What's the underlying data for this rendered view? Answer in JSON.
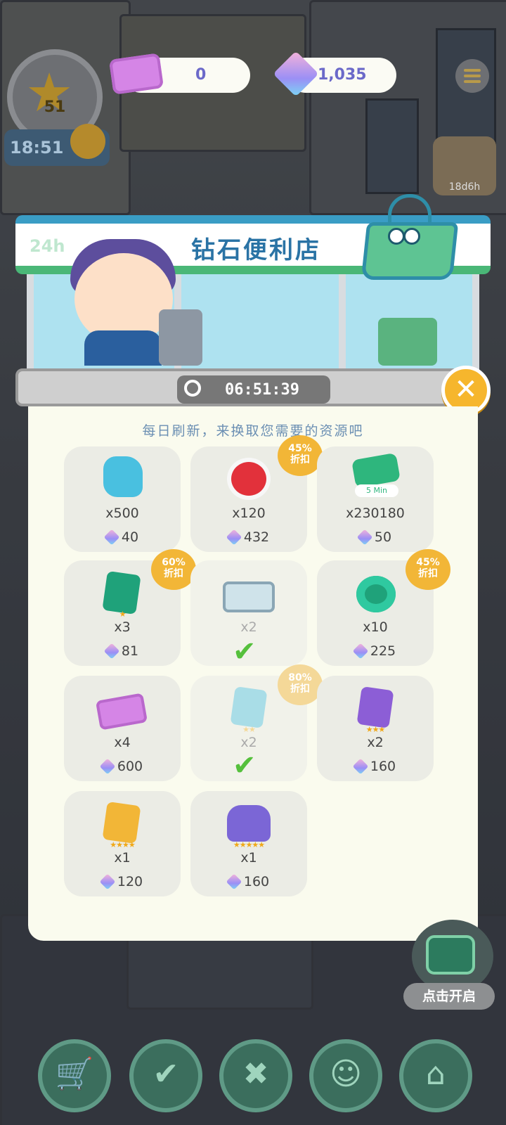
{
  "hud": {
    "level": "51",
    "time": "18:51",
    "tickets": "0",
    "diamonds": "1,035",
    "side_timer": "18d6h"
  },
  "shop": {
    "tag_24h": "24h",
    "title": "钻石便利店",
    "countdown": "06:51:39",
    "subtitle": "每日刷新，来换取您需要的资源吧",
    "items": [
      {
        "icon": "blue-puzzle-icon",
        "qty": "x500",
        "price": "40",
        "badge": "",
        "purchased": false
      },
      {
        "icon": "red-flower-icon",
        "qty": "x120",
        "price": "432",
        "badge": "45%\n折扣",
        "purchased": false
      },
      {
        "icon": "time-skip-ticket-icon",
        "icon_label": "5 Min",
        "qty": "x230180",
        "price": "50",
        "badge": "",
        "purchased": false
      },
      {
        "icon": "green-card-pack-1star-icon",
        "qty": "x3",
        "price": "81",
        "badge": "60%\n折扣",
        "purchased": false
      },
      {
        "icon": "video-player-icon",
        "qty": "x2",
        "price": "",
        "badge": "",
        "purchased": true
      },
      {
        "icon": "crown-coin-icon",
        "qty": "x10",
        "price": "225",
        "badge": "45%\n折扣",
        "purchased": false
      },
      {
        "icon": "pink-ticket-icon",
        "qty": "x4",
        "price": "600",
        "badge": "",
        "purchased": false
      },
      {
        "icon": "blue-card-pack-2star-icon",
        "qty": "x2",
        "price": "",
        "badge": "80%\n折扣",
        "purchased": true
      },
      {
        "icon": "purple-card-pack-3star-icon",
        "qty": "x2",
        "price": "160",
        "badge": "",
        "purchased": false
      },
      {
        "icon": "gold-card-pack-4star-icon",
        "qty": "x1",
        "price": "120",
        "badge": "",
        "purchased": false
      },
      {
        "icon": "purple-backpack-5star-icon",
        "qty": "x1",
        "price": "160",
        "badge": "",
        "purchased": false
      }
    ]
  },
  "ad": {
    "label": "点击开启"
  },
  "nav": [
    {
      "name": "shop-cart-icon",
      "glyph": "🛒"
    },
    {
      "name": "tasks-icon",
      "glyph": "✔"
    },
    {
      "name": "tools-icon",
      "glyph": "✖"
    },
    {
      "name": "emoji-icon",
      "glyph": "☺"
    },
    {
      "name": "home-icon",
      "glyph": "⌂"
    }
  ],
  "colors": {
    "accent": "#f6b62d",
    "title": "#2a73a5",
    "check": "#55c03c",
    "awning_green": "#4ab777",
    "awning_blue": "#3a9dc5"
  }
}
